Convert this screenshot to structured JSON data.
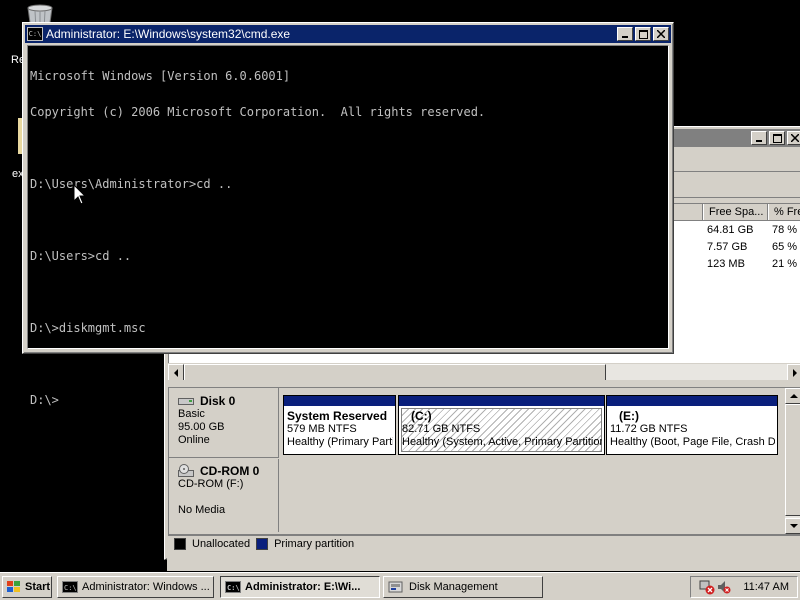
{
  "desktop": {
    "fragments": [
      "Re",
      "ex"
    ]
  },
  "cmd_window": {
    "title": "Administrator: E:\\Windows\\system32\\cmd.exe",
    "app_icon_glyph": "C:\\",
    "lines": [
      "Microsoft Windows [Version 6.0.6001]",
      "Copyright (c) 2006 Microsoft Corporation.  All rights reserved.",
      "",
      "D:\\Users\\Administrator>cd ..",
      "",
      "D:\\Users>cd ..",
      "",
      "D:\\>diskmgmt.msc",
      "",
      "D:\\>"
    ]
  },
  "disk_mgmt": {
    "columns": {
      "free_space": "Free Spa...",
      "percent_free": "% Fre"
    },
    "volumes": [
      {
        "free": "64.81 GB",
        "pct": "78 %"
      },
      {
        "free": "7.57 GB",
        "pct": "65 %"
      },
      {
        "free": "123 MB",
        "pct": "21 %"
      }
    ],
    "disks": [
      {
        "name": "Disk 0",
        "type": "Basic",
        "size": "95.00 GB",
        "status": "Online",
        "partitions": [
          {
            "name": "System Reserved",
            "size": "579 MB NTFS",
            "status": "Healthy (Primary Parti"
          },
          {
            "name": "(C:)",
            "size": "82.71 GB NTFS",
            "status": "Healthy (System, Active, Primary Partition"
          },
          {
            "name": "(E:)",
            "size": "11.72 GB NTFS",
            "status": "Healthy (Boot, Page File, Crash D"
          }
        ]
      },
      {
        "name": "CD-ROM 0",
        "type": "CD-ROM (F:)",
        "status": "No Media"
      }
    ],
    "legend": [
      {
        "label": "Unallocated",
        "color": "#000000"
      },
      {
        "label": "Primary partition",
        "color": "#0a1f7c"
      }
    ]
  },
  "taskbar": {
    "start_label": "Start",
    "buttons": [
      {
        "label": "Administrator: Windows ..."
      },
      {
        "label": "Administrator: E:\\Wi..."
      },
      {
        "label": "Disk Management"
      }
    ],
    "clock": "11:47 AM"
  },
  "colors": {
    "active_title": "#0a246a",
    "inactive_title": "#808080",
    "window_face": "#d4d0c8",
    "primary_partition": "#0a1f7c"
  }
}
